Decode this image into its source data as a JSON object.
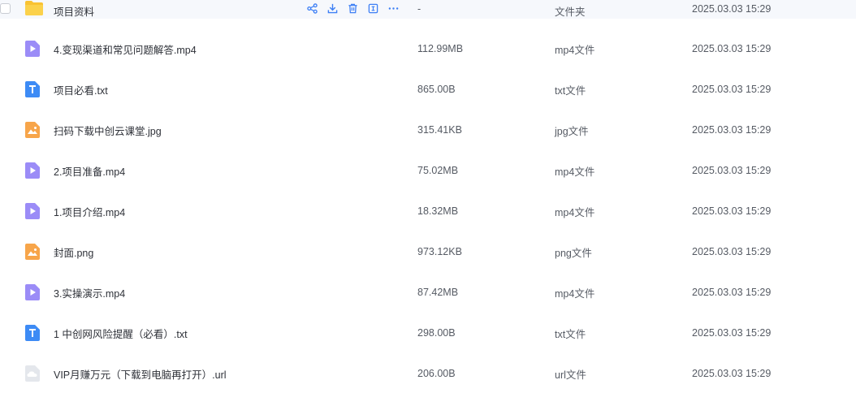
{
  "rows": [
    {
      "name": "项目资料",
      "size": "-",
      "type": "文件夹",
      "date": "2025.03.03 15:29",
      "icon": "folder-icon"
    },
    {
      "name": "4.变现渠道和常见问题解答.mp4",
      "size": "112.99MB",
      "type": "mp4文件",
      "date": "2025.03.03 15:29",
      "icon": "video-file-icon"
    },
    {
      "name": "项目必看.txt",
      "size": "865.00B",
      "type": "txt文件",
      "date": "2025.03.03 15:29",
      "icon": "text-file-icon"
    },
    {
      "name": "扫码下载中创云课堂.jpg",
      "size": "315.41KB",
      "type": "jpg文件",
      "date": "2025.03.03 15:29",
      "icon": "image-file-icon"
    },
    {
      "name": "2.项目准备.mp4",
      "size": "75.02MB",
      "type": "mp4文件",
      "date": "2025.03.03 15:29",
      "icon": "video-file-icon"
    },
    {
      "name": "1.项目介绍.mp4",
      "size": "18.32MB",
      "type": "mp4文件",
      "date": "2025.03.03 15:29",
      "icon": "video-file-icon"
    },
    {
      "name": "封面.png",
      "size": "973.12KB",
      "type": "png文件",
      "date": "2025.03.03 15:29",
      "icon": "image-file-icon"
    },
    {
      "name": "3.实操演示.mp4",
      "size": "87.42MB",
      "type": "mp4文件",
      "date": "2025.03.03 15:29",
      "icon": "video-file-icon"
    },
    {
      "name": "1 中创网风险提醒（必看）.txt",
      "size": "298.00B",
      "type": "txt文件",
      "date": "2025.03.03 15:29",
      "icon": "text-file-icon"
    },
    {
      "name": "VIP月赚万元（下载到电脑再打开）.url",
      "size": "206.00B",
      "type": "url文件",
      "date": "2025.03.03 15:29",
      "icon": "link-file-icon"
    }
  ],
  "row_actions": [
    "share-icon",
    "download-icon",
    "delete-icon",
    "rename-icon",
    "more-icon"
  ],
  "colors": {
    "folder": "#f9c233",
    "video": "#9b8cf7",
    "text": "#3d8bf5",
    "image": "#f7a54a",
    "link": "#cfd3da",
    "action": "#3d7ff5",
    "hover_bg": "#f6f8fc"
  }
}
